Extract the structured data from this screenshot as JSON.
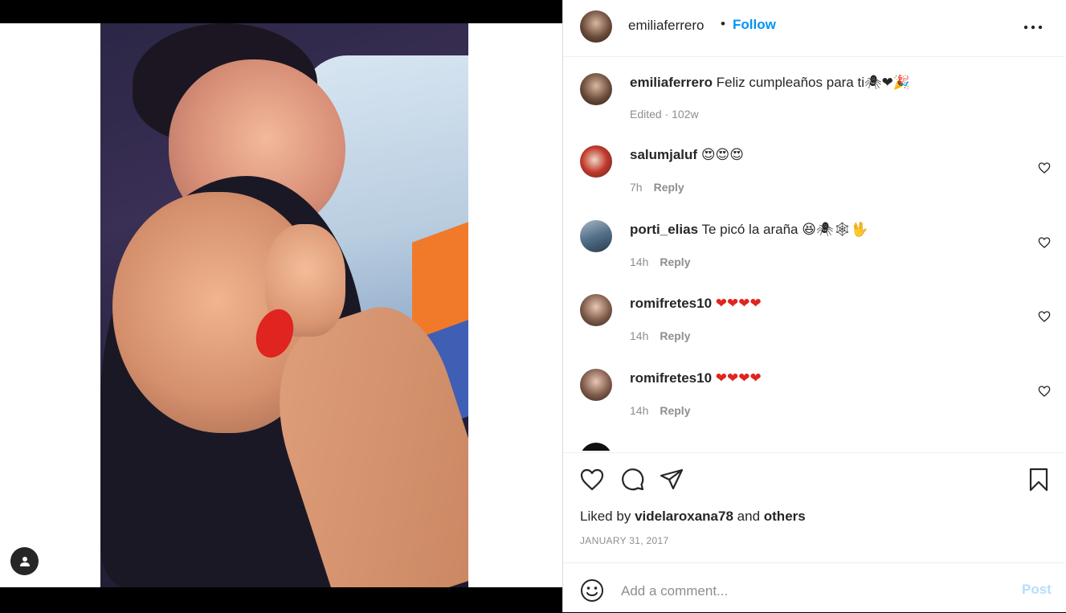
{
  "post": {
    "author": "emiliaferrero",
    "follow_label": "Follow",
    "separator": "•"
  },
  "caption": {
    "username": "emiliaferrero",
    "text": "Feliz cumpleaños para ti",
    "emojis": "🕷❤🎉",
    "meta": "Edited · 102w"
  },
  "comments": [
    {
      "username": "salumjaluf",
      "text": "",
      "emojis": "😍😍😍",
      "time": "7h",
      "reply": "Reply"
    },
    {
      "username": "porti_elias",
      "text": "Te picó la araña",
      "emojis": "😆🕷🕸🖖",
      "time": "14h",
      "reply": "Reply"
    },
    {
      "username": "romifretes10",
      "text": "",
      "emojis": "❤❤❤❤",
      "time": "14h",
      "reply": "Reply"
    },
    {
      "username": "romifretes10",
      "text": "",
      "emojis": "❤❤❤❤",
      "time": "14h",
      "reply": "Reply"
    }
  ],
  "likes": {
    "prefix": "Liked by",
    "user": "videlaroxana78",
    "conj": "and",
    "others": "others"
  },
  "date": "JANUARY 31, 2017",
  "composer": {
    "placeholder": "Add a comment...",
    "post_label": "Post"
  },
  "icons": [
    "heart-icon",
    "comment-icon",
    "share-icon",
    "bookmark-icon",
    "smile-icon",
    "more-icon",
    "user-icon"
  ],
  "colors": {
    "follow": "#0095f6",
    "post_disabled": "#b2dffc",
    "meta": "#8e8e8e"
  }
}
